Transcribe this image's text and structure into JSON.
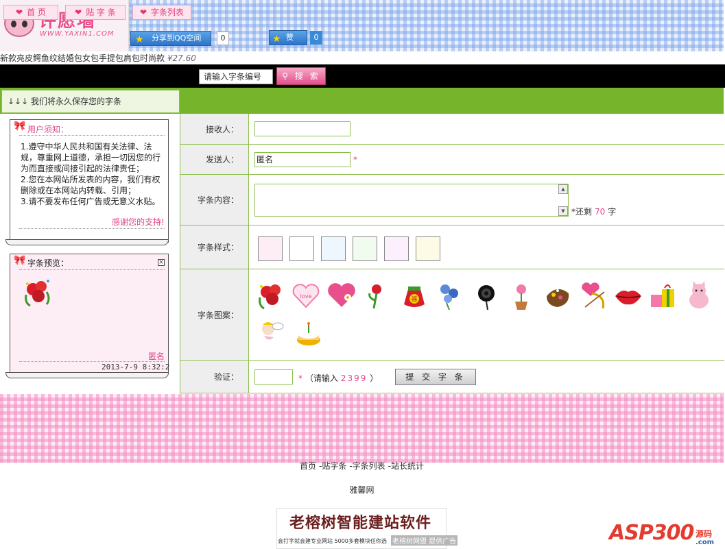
{
  "header": {
    "logo_title": "许愿墙",
    "logo_url": "WWW.YAXIN1.COM",
    "share_label": "分享到QQ空间",
    "share_count": "0",
    "like_label": "赞",
    "like_count": "0"
  },
  "promo": {
    "text": "新款亮皮鳄鱼纹结婚包女包手提包肩包时尚款",
    "price": "¥27.60"
  },
  "nav": {
    "home": "首 页",
    "post": "贴 字 条",
    "list": "字条列表",
    "search_placeholder": "请输入字条编号",
    "search_button": "搜 索"
  },
  "banner": {
    "text": "↓↓↓ 我们将永久保存您的字条"
  },
  "notice": {
    "title": "用户须知：",
    "lines": [
      "1.遵守中华人民共和国有关法律、法规，尊重网上道德，承担一切因您的行为而直接或间接引起的法律责任；",
      "2.您在本网站所发表的内容，我们有权删除或在本网站内转载、引用；",
      "3.请不要发布任何广告或无意义水贴。"
    ],
    "thanks": "感谢您的支持!"
  },
  "preview": {
    "title": "字条预览：",
    "sender": "匿名",
    "time": "2013-7-9 8:32:2"
  },
  "form": {
    "receiver_label": "接收人：",
    "sender_label": "发送人：",
    "sender_value": "匿名",
    "content_label": "字条内容：",
    "remain_prefix": "*还剩",
    "remain_count": "70",
    "remain_suffix": "字",
    "style_label": "字条样式：",
    "pattern_label": "字条图案：",
    "verify_label": "验证：",
    "verify_prefix": "（请输入",
    "verify_code": "2399",
    "verify_suffix": "）",
    "submit": "提 交 字 条",
    "required_mark": "*"
  },
  "swatches": [
    "#fdeef5",
    "#ffffff",
    "#eef7fd",
    "#f1fbef",
    "#fcf0fc",
    "#fdfbe6"
  ],
  "stickers": [
    "rose-bouquet-icon",
    "heart-love-icon",
    "heart-flower-icon",
    "rose-icon",
    "lucky-bag-icon",
    "blue-roses-icon",
    "black-rose-icon",
    "potted-rose-icon",
    "chocolate-icon",
    "cupid-arrow-icon",
    "lips-icon",
    "gift-box-icon",
    "pink-cat-icon",
    "cupid-angel-icon",
    "birthday-cake-icon"
  ],
  "footer": {
    "links": [
      "首页",
      "-贴字条",
      "-字条列表",
      "-站长统计"
    ],
    "site": "雅馨网"
  },
  "ads": {
    "banner_title": "老榕树智能建站软件",
    "banner_sub": "会打字就会建专业网站 5000多套模块任你选",
    "banner_brand": "老榕树网盟 提供广告",
    "asp_text": "ASP300",
    "asp_yuanma": "源码",
    "asp_com": ".com"
  },
  "colors": {
    "green": "#76b52b",
    "pink": "#e0458a",
    "blue_gingham": "#7aa2e9",
    "pink_gingham": "#f48ec3"
  }
}
